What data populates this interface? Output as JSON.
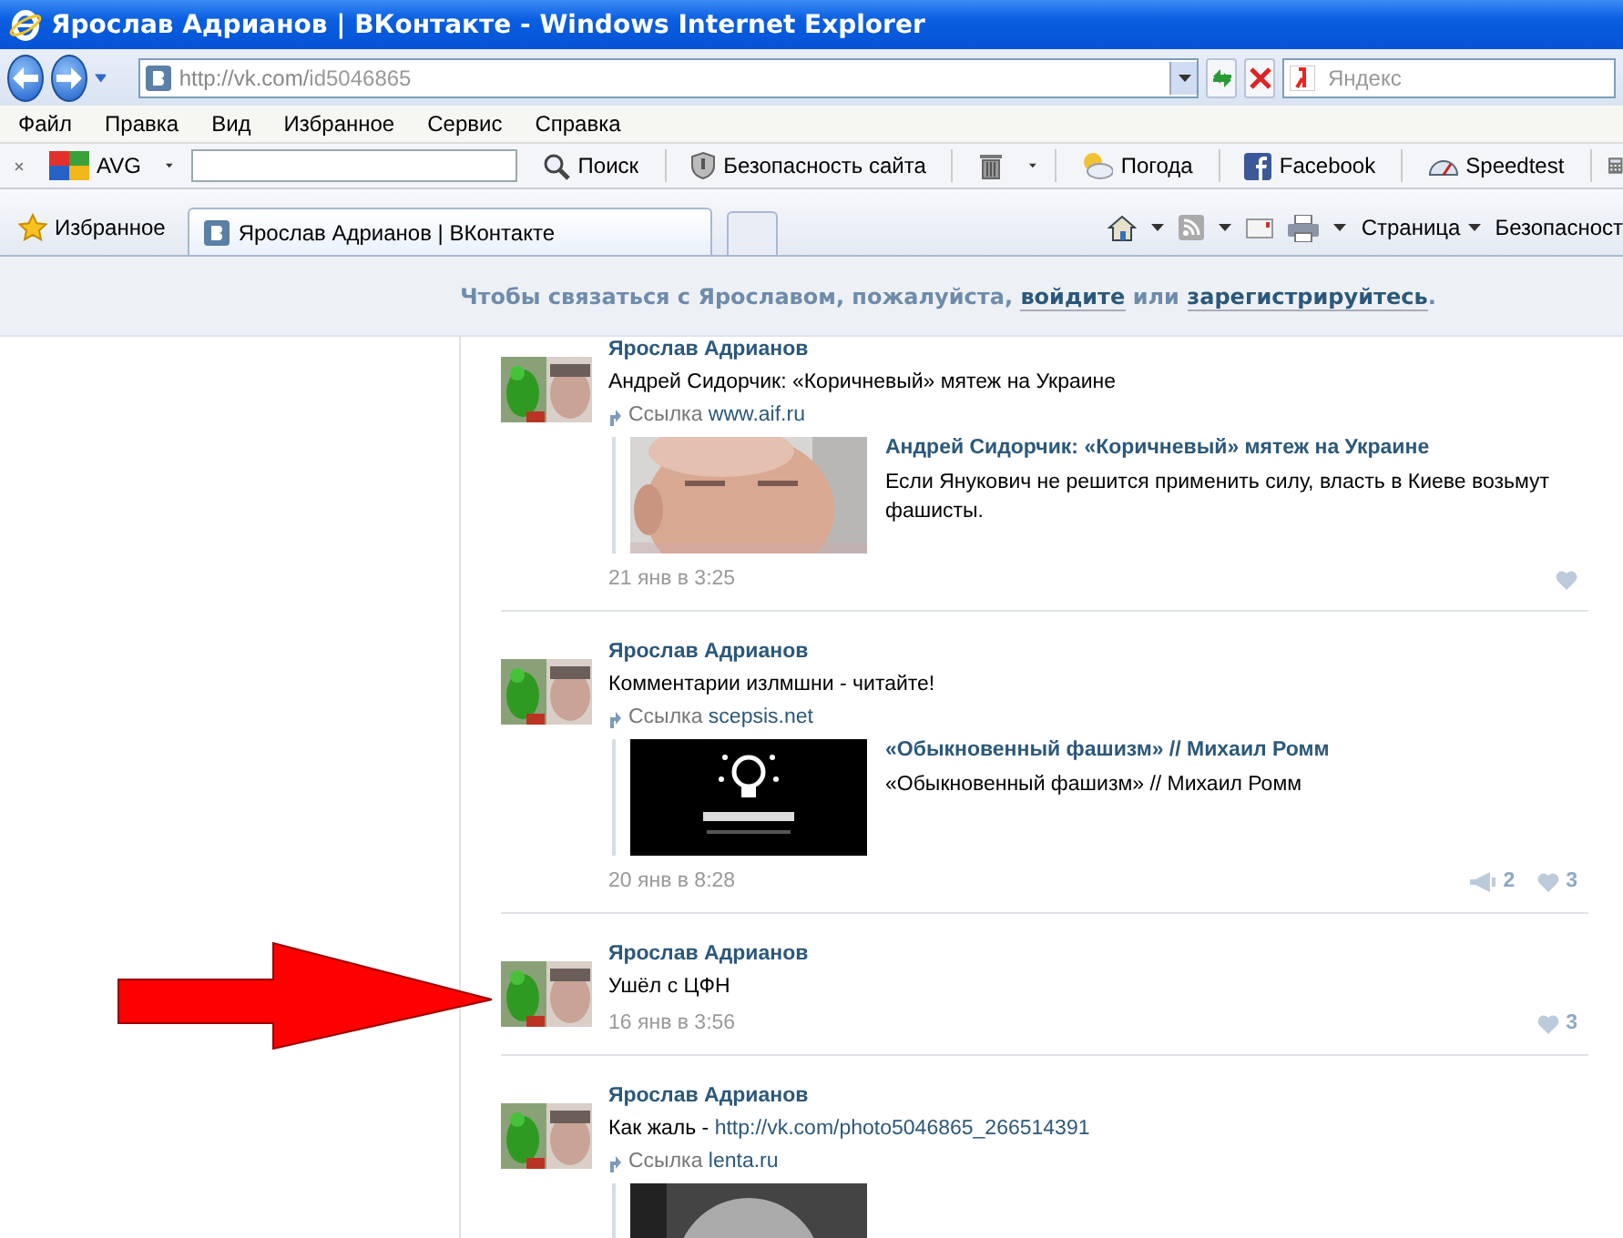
{
  "window": {
    "title": "Ярослав Адрианов | ВКонтакте - Windows Internet Explorer"
  },
  "address_bar": {
    "url_host": "http://vk.com/",
    "url_path": "id5046865",
    "search_placeholder": "Яндекс"
  },
  "menu": [
    "Файл",
    "Правка",
    "Вид",
    "Избранное",
    "Сервис",
    "Справка"
  ],
  "toolbar": {
    "brand": "AVG",
    "buttons": [
      {
        "kind": "search",
        "label": "Поиск"
      },
      {
        "kind": "shield",
        "label": "Безопасность сайта"
      },
      {
        "kind": "trash"
      },
      {
        "kind": "weather",
        "label": "Погода"
      },
      {
        "kind": "facebook",
        "label": "Facebook"
      },
      {
        "kind": "gauge",
        "label": "Speedtest"
      }
    ]
  },
  "favorites_bar": {
    "favorites": "Избранное",
    "tabs": [
      {
        "label": "Ярослав Адрианов | ВКонтакте",
        "selected": true
      }
    ],
    "commands": [
      "Страница",
      "Безопасност"
    ]
  },
  "banner": {
    "prefix": "Чтобы связаться с Ярославом, пожалуйста,",
    "login": "войдите",
    "middle": "или",
    "register": "зарегистрируйтесь",
    "suffix": "."
  },
  "posts": [
    {
      "author": "Ярослав Адрианов",
      "text": "Андрей Сидорчик: «Коричневый» мятеж на Украине",
      "source": {
        "label": "Ссылка",
        "domain": "www.aif.ru"
      },
      "preview": {
        "kind": "face",
        "title": "Андрей Сидорчик: «Коричневый» мятеж на Украине",
        "description": "Если Янукович не решится применить силу, власть в Киеве возьмут фашисты."
      },
      "date": "21 янв в 3:25"
    },
    {
      "author": "Ярослав Адрианов",
      "text": "Комментарии излмшни - читайте!",
      "source": {
        "label": "Ссылка",
        "domain": "scepsis.net"
      },
      "preview": {
        "kind": "logo",
        "title": "«Обыкновенный фашизм» // Михаил Ромм",
        "description": "«Обыкновенный фашизм» // Михаил Ромм"
      },
      "date": "20 янв в 8:28",
      "reposts": "2",
      "likes": "3"
    },
    {
      "author": "Ярослав Адрианов",
      "text": "Ушёл с ЦФН",
      "date": "16 янв в 3:56",
      "likes": "3"
    },
    {
      "author": "Ярослав Адрианов",
      "text": "Как жаль -",
      "text_link": "http://vk.com/photo5046865_266514391",
      "source": {
        "label": "Ссылка",
        "domain": "lenta.ru"
      },
      "preview": {
        "kind": "face_bw"
      }
    }
  ]
}
